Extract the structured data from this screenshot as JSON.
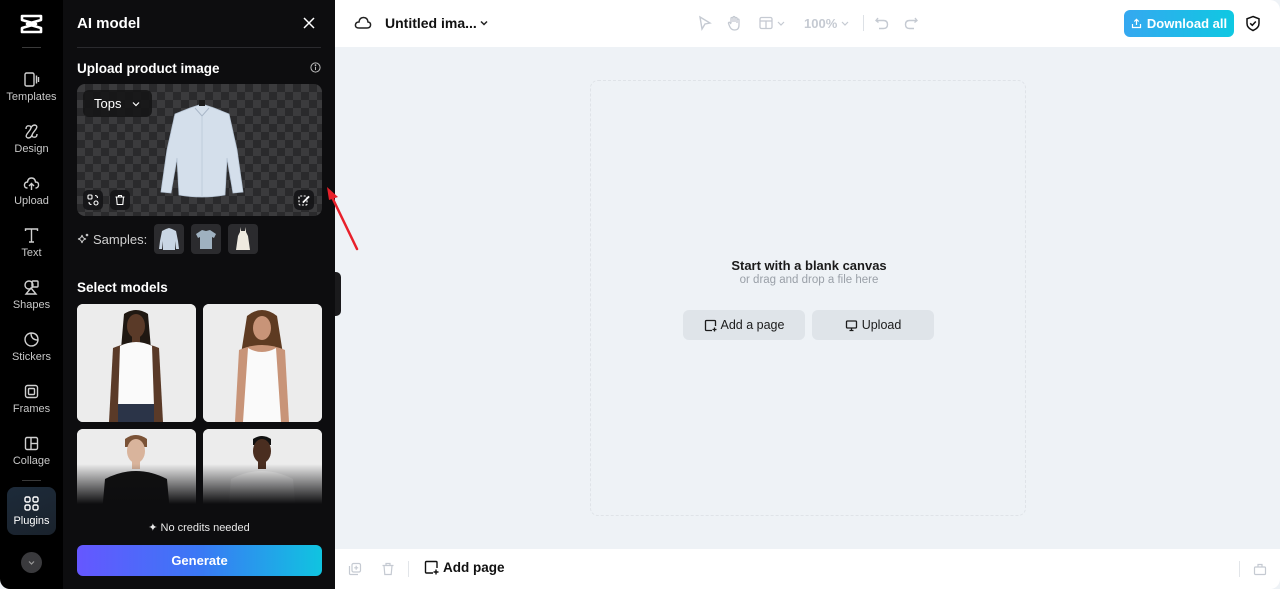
{
  "rail": {
    "logo": "capcut-logo-icon",
    "items": [
      {
        "label": "Templates",
        "icon": "templates-icon"
      },
      {
        "label": "Design",
        "icon": "design-icon"
      },
      {
        "label": "Upload",
        "icon": "upload-cloud-icon"
      },
      {
        "label": "Text",
        "icon": "text-icon"
      },
      {
        "label": "Shapes",
        "icon": "shapes-icon"
      },
      {
        "label": "Stickers",
        "icon": "stickers-icon"
      },
      {
        "label": "Frames",
        "icon": "frames-icon"
      },
      {
        "label": "Collage",
        "icon": "collage-icon"
      },
      {
        "label": "Plugins",
        "icon": "plugins-icon",
        "active": true
      }
    ],
    "more_icon": "chevron-down-icon"
  },
  "panel": {
    "title": "AI model",
    "upload_section_title": "Upload product image",
    "category_select": "Tops",
    "samples_label": "Samples:",
    "samples": [
      "Long-sleeve shirt",
      "T-shirt",
      "Dress"
    ],
    "models_section_title": "Select models",
    "models": [
      "Model 1 - white mock neck top, jeans",
      "Model 2 - white tank top",
      "Model 3 - black sweater",
      "Model 4 - white t-shirt"
    ],
    "credits_text": "No credits needed",
    "generate_label": "Generate"
  },
  "topbar": {
    "doc_title": "Untitled ima...",
    "zoom": "100%",
    "download_label": "Download all"
  },
  "canvas": {
    "title": "Start with a blank canvas",
    "subtitle": "or drag and drop a file here",
    "add_page_label": "Add a page",
    "upload_label": "Upload"
  },
  "bottombar": {
    "add_page_label": "Add page"
  },
  "colors": {
    "panel_bg": "#0d0d0f",
    "canvas_bg": "#eef2f6",
    "generate_gradient": [
      "#6557ff",
      "#10c4e0"
    ],
    "download_gradient": [
      "#35a8f0",
      "#0fc8e2"
    ],
    "annotation_arrow": "#e8202a"
  }
}
